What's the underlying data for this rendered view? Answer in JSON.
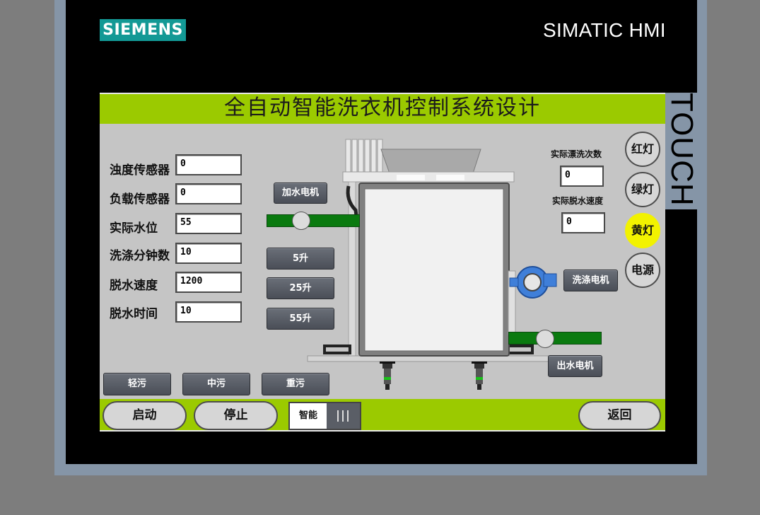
{
  "device": {
    "brand_logo": "SIEMENS",
    "brand_title": "SIMATIC HMI",
    "touch_label": "TOUCH"
  },
  "screen": {
    "title": "全自动智能洗衣机控制系统设计"
  },
  "sensors": [
    {
      "label": "浊度传感器",
      "value": "0"
    },
    {
      "label": "负载传感器",
      "value": "0"
    },
    {
      "label": "实际水位",
      "value": "55"
    },
    {
      "label": "洗涤分钟数",
      "value": "10"
    },
    {
      "label": "脱水速度",
      "value": "1200"
    },
    {
      "label": "脱水时间",
      "value": "10"
    }
  ],
  "water_buttons": {
    "motor": "加水电机",
    "level_5": "5升",
    "level_25": "25升",
    "level_55": "55升"
  },
  "right_panel": {
    "rinse_count_label": "实际漂洗次数",
    "rinse_count_value": "0",
    "spin_speed_label": "实际脱水速度",
    "spin_speed_value": "0",
    "wash_motor": "洗涤电机",
    "drain_motor": "出水电机"
  },
  "lamps": [
    {
      "label": "红灯",
      "on": false,
      "color": "#d6d6d6"
    },
    {
      "label": "绿灯",
      "on": false,
      "color": "#d6d6d6"
    },
    {
      "label": "黄灯",
      "on": true,
      "color": "#f2f200"
    },
    {
      "label": "电源",
      "on": false,
      "color": "#d6d6d6"
    }
  ],
  "dirt_buttons": [
    "轻污",
    "中污",
    "重污"
  ],
  "controls": {
    "start": "启动",
    "stop": "停止",
    "mode": "智能",
    "mode_switch_icon": "switch-bars-icon",
    "back": "返回"
  },
  "colors": {
    "accent_green": "#9bca00",
    "pipe_green": "#0a7a0f",
    "brand_teal": "#139995",
    "lamp_yellow": "#f2f200"
  }
}
